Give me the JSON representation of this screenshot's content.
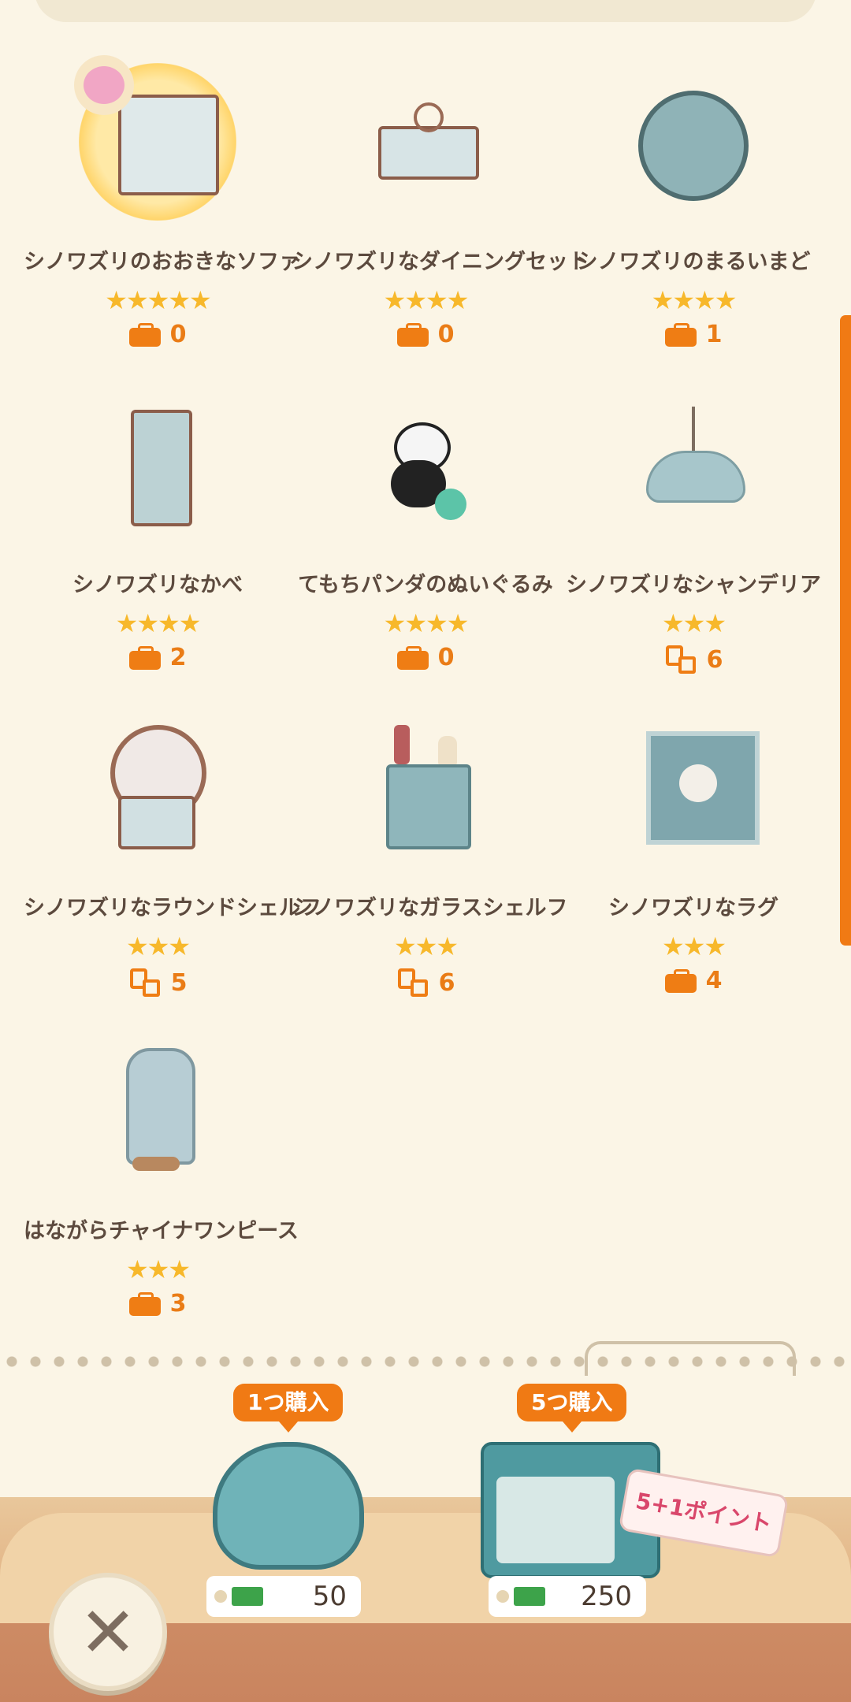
{
  "items": [
    {
      "name": "シノワズリのおおきなソファ",
      "stars": "★★★★★",
      "count": "0",
      "icon": "bag-icon",
      "thumb": "canopy-sofa"
    },
    {
      "name": "シノワズリなダイニングセット",
      "stars": "★★★★",
      "count": "0",
      "icon": "bag-icon",
      "thumb": "dining-set"
    },
    {
      "name": "シノワズリのまるいまど",
      "stars": "★★★★",
      "count": "1",
      "icon": "bag-icon",
      "thumb": "round-window"
    },
    {
      "name": "シノワズリなかべ",
      "stars": "★★★★",
      "count": "2",
      "icon": "bag-icon",
      "thumb": "wall-panel"
    },
    {
      "name": "てもちパンダのぬいぐるみ",
      "stars": "★★★★",
      "count": "0",
      "icon": "bag-icon",
      "thumb": "panda-plush"
    },
    {
      "name": "シノワズリなシャンデリア",
      "stars": "★★★",
      "count": "6",
      "icon": "furniture-icon",
      "thumb": "chandelier"
    },
    {
      "name": "シノワズリなラウンドシェルフ",
      "stars": "★★★",
      "count": "5",
      "icon": "furniture-icon",
      "thumb": "round-shelf"
    },
    {
      "name": "シノワズリなガラスシェルフ",
      "stars": "★★★",
      "count": "6",
      "icon": "furniture-icon",
      "thumb": "glass-shelf"
    },
    {
      "name": "シノワズリなラグ",
      "stars": "★★★",
      "count": "4",
      "icon": "bag-icon",
      "thumb": "rug"
    },
    {
      "name": "はながらチャイナワンピース",
      "stars": "★★★",
      "count": "3",
      "icon": "bag-icon",
      "thumb": "china-dress"
    }
  ],
  "shop": {
    "buy_one_label": "1つ購入",
    "buy_five_label": "5つ購入",
    "price_one": "50",
    "price_five": "250",
    "bonus_tag": "5+1ポイント"
  },
  "colors": {
    "accent": "#f07a14",
    "background": "#fbf5e6",
    "star": "#f7b82b"
  }
}
